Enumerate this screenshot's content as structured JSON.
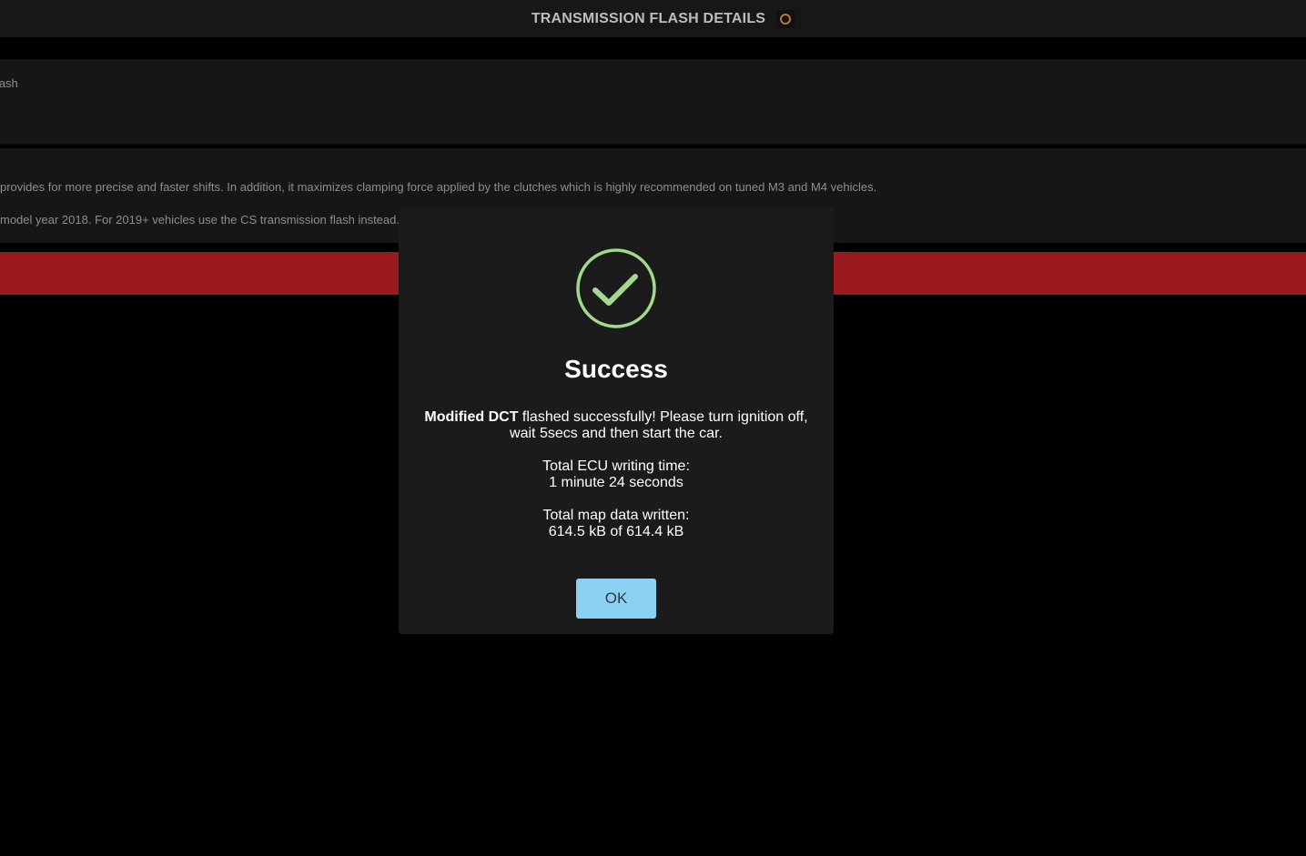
{
  "header": {
    "title": "TRANSMISSION FLASH DETAILS",
    "icon": "ring-icon",
    "icon_color": "#b87a2a"
  },
  "panel1": {
    "text": "Flash"
  },
  "panel2": {
    "line1": "provides for more precise and faster shifts. In addition, it maximizes clamping force applied by the clutches which is highly recommended on tuned M3 and M4 vehicles.",
    "line2": "model year 2018. For 2019+ vehicles use the CS transmission flash instead."
  },
  "accent": {
    "red_bar": "#9b1a1e",
    "success_green": "#a2d98c",
    "ok_button": "#8ad1f2"
  },
  "modal": {
    "title": "Success",
    "message_strong": "Modified DCT",
    "message_line1_rest": " flashed successfully! Please turn ignition off,",
    "message_line2": "wait 5secs and then start the car.",
    "time_label": "Total ECU writing time:",
    "time_value": "1 minute 24 seconds",
    "data_label": "Total map data written:",
    "data_value": "614.5 kB of 614.4 kB",
    "ok_label": "OK"
  }
}
